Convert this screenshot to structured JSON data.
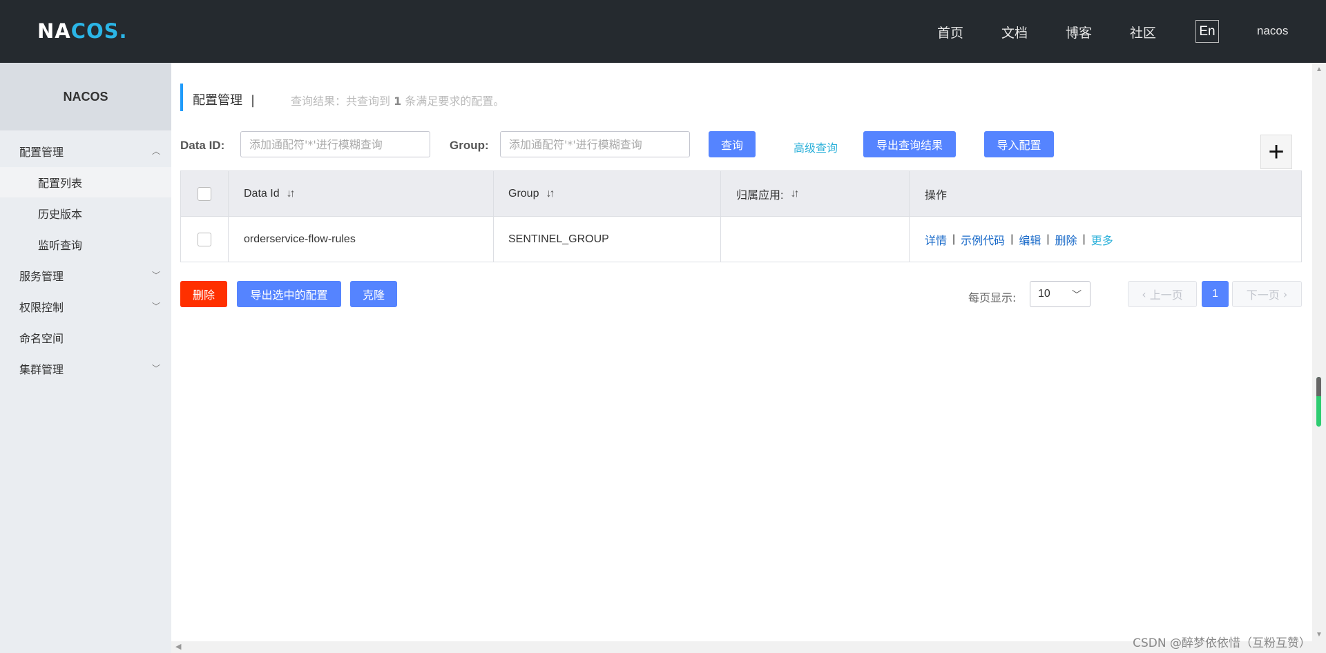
{
  "header": {
    "logo_main": "NA",
    "logo_accent": "COS",
    "logo_dot": ".",
    "nav": [
      "首页",
      "文档",
      "博客",
      "社区"
    ],
    "lang": "En",
    "user": "nacos"
  },
  "sidebar": {
    "title": "NACOS",
    "items": [
      {
        "label": "配置管理"
      },
      {
        "label": "配置列表"
      },
      {
        "label": "历史版本"
      },
      {
        "label": "监听查询"
      },
      {
        "label": "服务管理"
      },
      {
        "label": "权限控制"
      },
      {
        "label": "命名空间"
      },
      {
        "label": "集群管理"
      }
    ]
  },
  "page": {
    "title": "配置管理",
    "title_sep": "|",
    "result_prefix": "查询结果：共查询到",
    "result_count": "1",
    "result_suffix": "条满足要求的配置。"
  },
  "filters": {
    "dataid_label": "Data ID:",
    "dataid_placeholder": "添加通配符'*'进行模糊查询",
    "group_label": "Group:",
    "group_placeholder": "添加通配符'*'进行模糊查询",
    "query_btn": "查询",
    "advanced_link": "高级查询",
    "export_btn": "导出查询结果",
    "import_btn": "导入配置",
    "add_btn": "+"
  },
  "table": {
    "headers": [
      "Data Id",
      "Group",
      "归属应用:",
      "操作"
    ],
    "sort_glyph": "↓↑",
    "rows": [
      {
        "data_id": "orderservice-flow-rules",
        "group": "SENTINEL_GROUP",
        "app": ""
      }
    ],
    "ops": {
      "detail": "详情",
      "sample": "示例代码",
      "edit": "编辑",
      "delete": "删除",
      "more": "更多",
      "sep": "|"
    }
  },
  "bulk": {
    "delete_btn": "删除",
    "export_selected_btn": "导出选中的配置",
    "clone_btn": "克隆"
  },
  "pagination": {
    "page_size_label": "每页显示:",
    "page_size": "10",
    "prev": "上一页",
    "current": "1",
    "next": "下一页"
  },
  "watermark": "CSDN @醉梦依依惜（互粉互赞）",
  "colors": {
    "topbar": "#252a2f",
    "primary": "#5584ff",
    "danger": "#ff3000",
    "accent": "#2bb5e6",
    "link": "#1b6bc9"
  }
}
